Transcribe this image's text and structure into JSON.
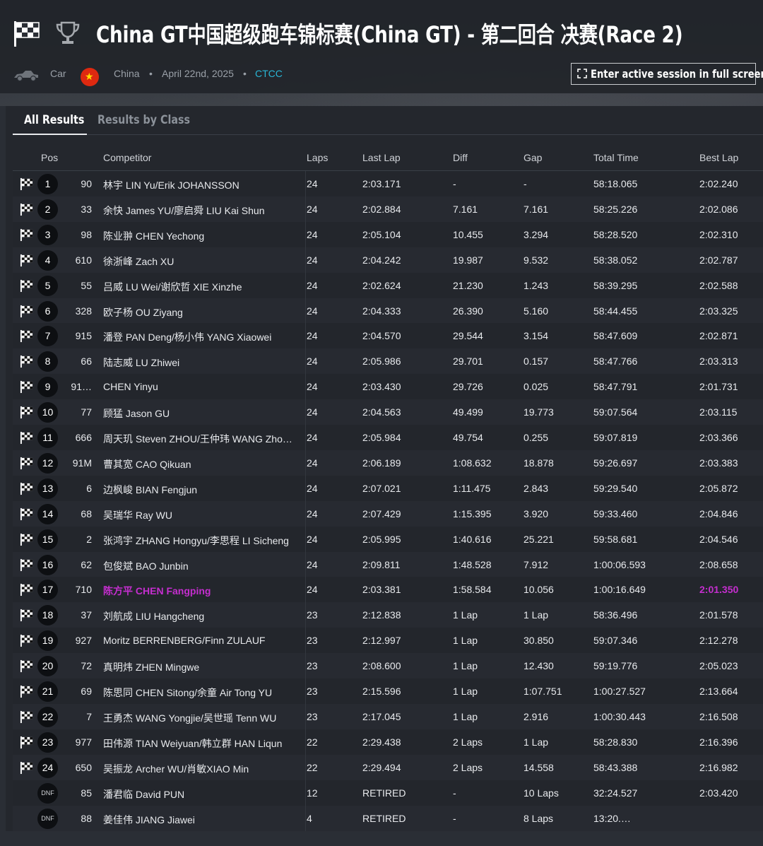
{
  "header": {
    "title": "China GT中国超级跑车锦标赛(China GT) - 第二回合 决赛(Race 2)",
    "category": "Car",
    "country": "China",
    "date": "April 22nd, 2025",
    "series": "CTCC",
    "fullscreen_label": "Enter active session in full screen"
  },
  "tabs": [
    {
      "label": "All Results",
      "active": true
    },
    {
      "label": "Results by Class",
      "active": false
    }
  ],
  "columns": {
    "pos": "Pos",
    "competitor": "Competitor",
    "laps": "Laps",
    "last_lap": "Last Lap",
    "diff": "Diff",
    "gap": "Gap",
    "total_time": "Total Time",
    "best_lap": "Best Lap"
  },
  "colors": {
    "accent": "#29b6d6",
    "fastest_lap": "#c52ecf",
    "row_dark": "#23262c",
    "row_light": "#272a31"
  },
  "results": [
    {
      "pos": "1",
      "num": "90",
      "competitor": "林宇 LIN Yu/Erik JOHANSSON",
      "laps": "24",
      "last_lap": "2:03.171",
      "diff": "-",
      "gap": "-",
      "total": "58:18.065",
      "best": "2:02.240",
      "flag": true
    },
    {
      "pos": "2",
      "num": "33",
      "competitor": "余快 James YU/廖启舜 LIU Kai Shun",
      "laps": "24",
      "last_lap": "2:02.884",
      "diff": "7.161",
      "gap": "7.161",
      "total": "58:25.226",
      "best": "2:02.086",
      "flag": true
    },
    {
      "pos": "3",
      "num": "98",
      "competitor": "陈业翀 CHEN Yechong",
      "laps": "24",
      "last_lap": "2:05.104",
      "diff": "10.455",
      "gap": "3.294",
      "total": "58:28.520",
      "best": "2:02.310",
      "flag": true
    },
    {
      "pos": "4",
      "num": "610",
      "competitor": "徐浙峰 Zach XU",
      "laps": "24",
      "last_lap": "2:04.242",
      "diff": "19.987",
      "gap": "9.532",
      "total": "58:38.052",
      "best": "2:02.787",
      "flag": true
    },
    {
      "pos": "5",
      "num": "55",
      "competitor": "吕威 LU Wei/谢欣哲 XIE Xinzhe",
      "laps": "24",
      "last_lap": "2:02.624",
      "diff": "21.230",
      "gap": "1.243",
      "total": "58:39.295",
      "best": "2:02.588",
      "flag": true
    },
    {
      "pos": "6",
      "num": "328",
      "competitor": "欧子杨 OU Ziyang",
      "laps": "24",
      "last_lap": "2:04.333",
      "diff": "26.390",
      "gap": "5.160",
      "total": "58:44.455",
      "best": "2:03.325",
      "flag": true
    },
    {
      "pos": "7",
      "num": "915",
      "competitor": "潘登 PAN Deng/杨小伟 YANG Xiaowei",
      "laps": "24",
      "last_lap": "2:04.570",
      "diff": "29.544",
      "gap": "3.154",
      "total": "58:47.609",
      "best": "2:02.871",
      "flag": true
    },
    {
      "pos": "8",
      "num": "66",
      "competitor": "陆志威 LU Zhiwei",
      "laps": "24",
      "last_lap": "2:05.986",
      "diff": "29.701",
      "gap": "0.157",
      "total": "58:47.766",
      "best": "2:03.313",
      "flag": true
    },
    {
      "pos": "9",
      "num": "91…",
      "competitor": "CHEN Yinyu",
      "laps": "24",
      "last_lap": "2:03.430",
      "diff": "29.726",
      "gap": "0.025",
      "total": "58:47.791",
      "best": "2:01.731",
      "flag": true
    },
    {
      "pos": "10",
      "num": "77",
      "competitor": "顾猛 Jason GU",
      "laps": "24",
      "last_lap": "2:04.563",
      "diff": "49.499",
      "gap": "19.773",
      "total": "59:07.564",
      "best": "2:03.115",
      "flag": true
    },
    {
      "pos": "11",
      "num": "666",
      "competitor": "周天玑 Steven ZHOU/王仲玮 WANG Zho…",
      "laps": "24",
      "last_lap": "2:05.984",
      "diff": "49.754",
      "gap": "0.255",
      "total": "59:07.819",
      "best": "2:03.366",
      "flag": true
    },
    {
      "pos": "12",
      "num": "91M",
      "competitor": "曹其宽 CAO Qikuan",
      "laps": "24",
      "last_lap": "2:06.189",
      "diff": "1:08.632",
      "gap": "18.878",
      "total": "59:26.697",
      "best": "2:03.383",
      "flag": true
    },
    {
      "pos": "13",
      "num": "6",
      "competitor": "边枫峻 BIAN Fengjun",
      "laps": "24",
      "last_lap": "2:07.021",
      "diff": "1:11.475",
      "gap": "2.843",
      "total": "59:29.540",
      "best": "2:05.872",
      "flag": true
    },
    {
      "pos": "14",
      "num": "68",
      "competitor": "吴瑞华 Ray WU",
      "laps": "24",
      "last_lap": "2:07.429",
      "diff": "1:15.395",
      "gap": "3.920",
      "total": "59:33.460",
      "best": "2:04.846",
      "flag": true
    },
    {
      "pos": "15",
      "num": "2",
      "competitor": "张鸿宇 ZHANG Hongyu/李思程 LI Sicheng",
      "laps": "24",
      "last_lap": "2:05.995",
      "diff": "1:40.616",
      "gap": "25.221",
      "total": "59:58.681",
      "best": "2:04.546",
      "flag": true
    },
    {
      "pos": "16",
      "num": "62",
      "competitor": "包俊斌 BAO Junbin",
      "laps": "24",
      "last_lap": "2:09.811",
      "diff": "1:48.528",
      "gap": "7.912",
      "total": "1:00:06.593",
      "best": "2:08.658",
      "flag": true
    },
    {
      "pos": "17",
      "num": "710",
      "competitor": "陈方平 CHEN Fangping",
      "laps": "24",
      "last_lap": "2:03.381",
      "diff": "1:58.584",
      "gap": "10.056",
      "total": "1:00:16.649",
      "best": "2:01.350",
      "flag": true,
      "fastest": true
    },
    {
      "pos": "18",
      "num": "37",
      "competitor": "刘航成 LIU Hangcheng",
      "laps": "23",
      "last_lap": "2:12.838",
      "diff": "1 Lap",
      "gap": "1 Lap",
      "total": "58:36.496",
      "best": "2:01.578",
      "flag": true
    },
    {
      "pos": "19",
      "num": "927",
      "competitor": "Moritz BERRENBERG/Finn ZULAUF",
      "laps": "23",
      "last_lap": "2:12.997",
      "diff": "1 Lap",
      "gap": "30.850",
      "total": "59:07.346",
      "best": "2:12.278",
      "flag": true
    },
    {
      "pos": "20",
      "num": "72",
      "competitor": "真明炜 ZHEN Mingwe",
      "laps": "23",
      "last_lap": "2:08.600",
      "diff": "1 Lap",
      "gap": "12.430",
      "total": "59:19.776",
      "best": "2:05.023",
      "flag": true
    },
    {
      "pos": "21",
      "num": "69",
      "competitor": "陈思同 CHEN Sitong/余童 Air Tong YU",
      "laps": "23",
      "last_lap": "2:15.596",
      "diff": "1 Lap",
      "gap": "1:07.751",
      "total": "1:00:27.527",
      "best": "2:13.664",
      "flag": true
    },
    {
      "pos": "22",
      "num": "7",
      "competitor": "王勇杰 WANG Yongjie/吴世瑶 Tenn WU",
      "laps": "23",
      "last_lap": "2:17.045",
      "diff": "1 Lap",
      "gap": "2.916",
      "total": "1:00:30.443",
      "best": "2:16.508",
      "flag": true
    },
    {
      "pos": "23",
      "num": "977",
      "competitor": "田伟源 TIAN Weiyuan/韩立群 HAN Liqun",
      "laps": "22",
      "last_lap": "2:29.438",
      "diff": "2 Laps",
      "gap": "1 Lap",
      "total": "58:28.830",
      "best": "2:16.396",
      "flag": true
    },
    {
      "pos": "24",
      "num": "650",
      "competitor": "吴振龙 Archer WU/肖敏XIAO Min",
      "laps": "22",
      "last_lap": "2:29.494",
      "diff": "2 Laps",
      "gap": "14.558",
      "total": "58:43.388",
      "best": "2:16.982",
      "flag": true
    },
    {
      "pos": "DNF",
      "num": "85",
      "competitor": "潘君临 David PUN",
      "laps": "12",
      "last_lap": "RETIRED",
      "diff": "-",
      "gap": "10 Laps",
      "total": "32:24.527",
      "best": "2:03.420",
      "flag": false
    },
    {
      "pos": "DNF",
      "num": "88",
      "competitor": "姜佳伟 JIANG Jiawei",
      "laps": "4",
      "last_lap": "RETIRED",
      "diff": "-",
      "gap": "8 Laps",
      "total": "13:20.…",
      "best": "",
      "flag": false
    }
  ]
}
